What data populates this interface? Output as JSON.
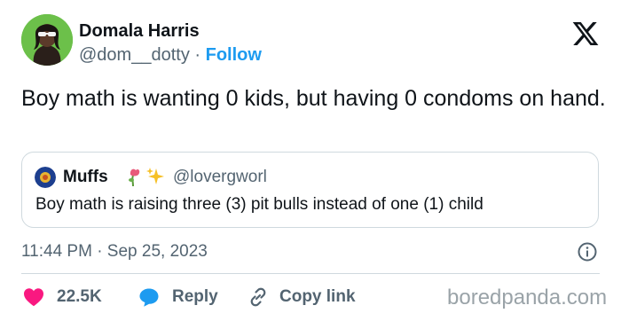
{
  "author": {
    "name": "Domala Harris",
    "handle": "@dom__dotty",
    "separator": "·",
    "follow_label": "Follow"
  },
  "tweet": {
    "text": "Boy math is wanting 0 kids, but having 0 condoms on hand."
  },
  "quote": {
    "name": "Muffs",
    "emoji_icons": [
      "rose-icon",
      "sparkles-icon"
    ],
    "handle": "@lovergworl",
    "text": "Boy math is raising three (3) pit bulls instead of one (1) child"
  },
  "meta": {
    "timestamp": "11:44 PM · Sep 25, 2023"
  },
  "actions": {
    "likes": "22.5K",
    "reply_label": "Reply",
    "copy_link_label": "Copy link"
  },
  "watermark": "boredpanda.com",
  "colors": {
    "accent": "#1d9bf0",
    "like": "#f91880",
    "text": "#0f1419",
    "secondary": "#536471",
    "border": "#cfd9de"
  }
}
